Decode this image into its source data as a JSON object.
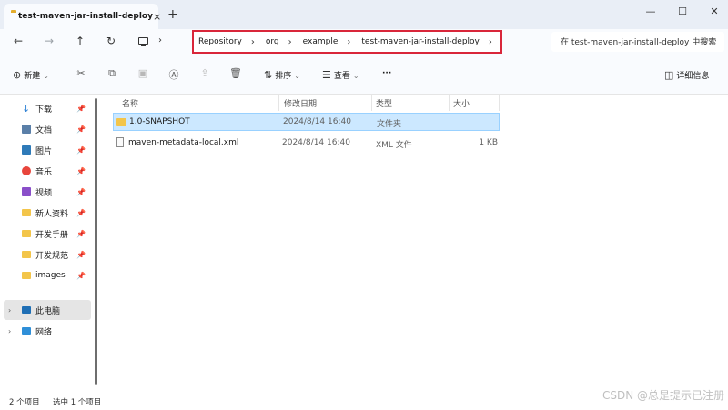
{
  "tab": {
    "title": "test-maven-jar-install-deploy",
    "close": "×",
    "add": "+"
  },
  "window": {
    "minimize": "—",
    "maximize": "☐",
    "close": "✕"
  },
  "nav": {
    "back": "←",
    "forward": "→",
    "up": "↑",
    "refresh": "↻",
    "chevron": "›"
  },
  "breadcrumbs": [
    {
      "label": "Repository"
    },
    {
      "label": "org"
    },
    {
      "label": "example"
    },
    {
      "label": "test-maven-jar-install-deploy"
    }
  ],
  "search": {
    "placeholder": "在 test-maven-jar-install-deploy 中搜索"
  },
  "toolbar": {
    "new_label": "新建",
    "sort_label": "排序",
    "view_label": "查看",
    "more": "···",
    "details_label": "详细信息"
  },
  "sidebar": {
    "quick": [
      {
        "label": "下载",
        "icon": "download-icon"
      },
      {
        "label": "文档",
        "icon": "document-icon"
      },
      {
        "label": "图片",
        "icon": "picture-icon"
      },
      {
        "label": "音乐",
        "icon": "music-icon"
      },
      {
        "label": "视频",
        "icon": "video-icon"
      },
      {
        "label": "新人资料",
        "icon": "folder-icon"
      },
      {
        "label": "开发手册",
        "icon": "folder-icon"
      },
      {
        "label": "开发规范",
        "icon": "folder-icon"
      },
      {
        "label": "images",
        "icon": "folder-icon"
      }
    ],
    "this_pc": "此电脑",
    "network": "网络"
  },
  "columns": {
    "name": "名称",
    "modified": "修改日期",
    "type": "类型",
    "size": "大小"
  },
  "files": [
    {
      "name": "1.0-SNAPSHOT",
      "modified": "2024/8/14 16:40",
      "type": "文件夹",
      "size": "",
      "selected": true
    },
    {
      "name": "maven-metadata-local.xml",
      "modified": "2024/8/14 16:40",
      "type": "XML 文件",
      "size": "1 KB",
      "selected": false
    }
  ],
  "status": {
    "count": "2 个项目",
    "selection": "选中 1 个项目"
  },
  "watermark": "CSDN @总是提示已注册"
}
